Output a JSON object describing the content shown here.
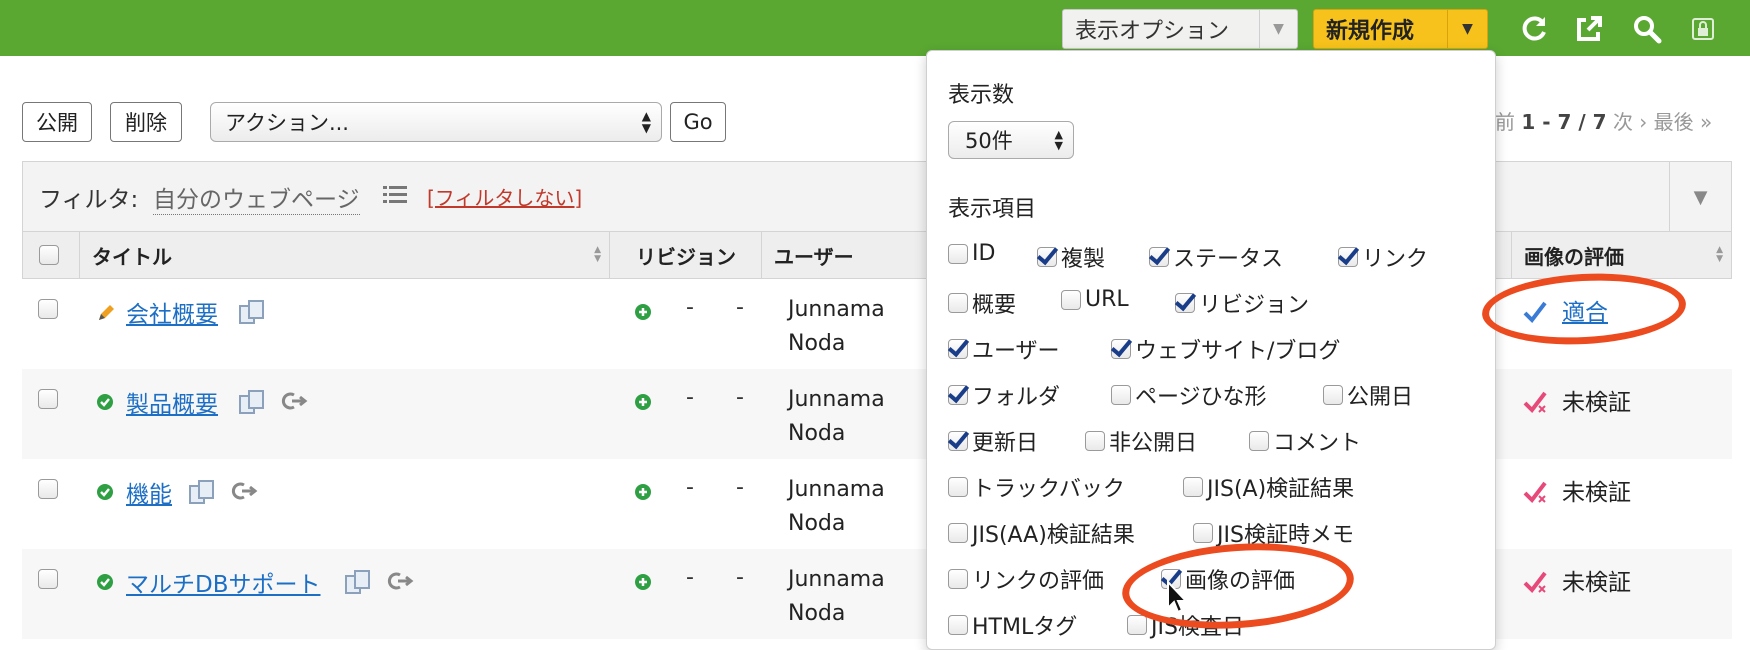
{
  "topbar": {
    "display_options_label": "表示オプション",
    "new_label": "新規作成",
    "icons": [
      "refresh-icon",
      "external-link-icon",
      "search-icon",
      "lock-icon"
    ]
  },
  "actions": {
    "publish_label": "公開",
    "delete_label": "削除",
    "action_select_value": "アクション...",
    "go_label": "Go"
  },
  "pager": {
    "prev": "前",
    "range": "1 - 7 / 7",
    "next": "次 ›",
    "last": "最後 »"
  },
  "filter": {
    "label": "フィルタ:",
    "value": "自分のウェブページ",
    "clear": "[フィルタしない]"
  },
  "table": {
    "headers": {
      "title": "タイトル",
      "revision": "リビジョン",
      "user": "ユーザー",
      "image_eval": "画像の評価"
    },
    "rows": [
      {
        "title": "会社概要",
        "status": "draft",
        "user_line1": "Junnama",
        "user_line2": "Noda",
        "dash1": "-",
        "dash2": "-",
        "eval": "適合",
        "eval_kind": "ok"
      },
      {
        "title": "製品概要",
        "status": "published",
        "user_line1": "Junnama",
        "user_line2": "Noda",
        "dash1": "-",
        "dash2": "-",
        "eval": "未検証",
        "eval_kind": "unverified"
      },
      {
        "title": "機能",
        "status": "published",
        "user_line1": "Junnama",
        "user_line2": "Noda",
        "dash1": "-",
        "dash2": "-",
        "eval": "未検証",
        "eval_kind": "unverified"
      },
      {
        "title": "マルチDBサポート",
        "status": "published",
        "user_line1": "Junnama",
        "user_line2": "Noda",
        "dash1": "-",
        "dash2": "-",
        "eval": "未検証",
        "eval_kind": "unverified"
      }
    ]
  },
  "panel": {
    "count_label": "表示数",
    "count_value": "50件",
    "columns_label": "表示項目",
    "options": [
      {
        "label": "ID",
        "checked": false
      },
      {
        "label": "複製",
        "checked": true
      },
      {
        "label": "ステータス",
        "checked": true
      },
      {
        "label": "リンク",
        "checked": true
      },
      {
        "label": "概要",
        "checked": false
      },
      {
        "label": "URL",
        "checked": false
      },
      {
        "label": "リビジョン",
        "checked": true
      },
      {
        "label": "ユーザー",
        "checked": true
      },
      {
        "label": "ウェブサイト/ブログ",
        "checked": true
      },
      {
        "label": "フォルダ",
        "checked": true
      },
      {
        "label": "ページひな形",
        "checked": false
      },
      {
        "label": "公開日",
        "checked": false
      },
      {
        "label": "更新日",
        "checked": true
      },
      {
        "label": "非公開日",
        "checked": false
      },
      {
        "label": "コメント",
        "checked": false
      },
      {
        "label": "トラックバック",
        "checked": false
      },
      {
        "label": "JIS(A)検証結果",
        "checked": false
      },
      {
        "label": "JIS(AA)検証結果",
        "checked": false
      },
      {
        "label": "JIS検証時メモ",
        "checked": false
      },
      {
        "label": "リンクの評価",
        "checked": false
      },
      {
        "label": "画像の評価",
        "checked": true
      },
      {
        "label": "HTMLタグ",
        "checked": false
      },
      {
        "label": "JIS検査日",
        "checked": false
      }
    ]
  },
  "colors": {
    "topbar": "#5aa832",
    "new_button": "#f6c21b",
    "highlight": "#ec4a1f",
    "link": "#1d6fc6"
  }
}
